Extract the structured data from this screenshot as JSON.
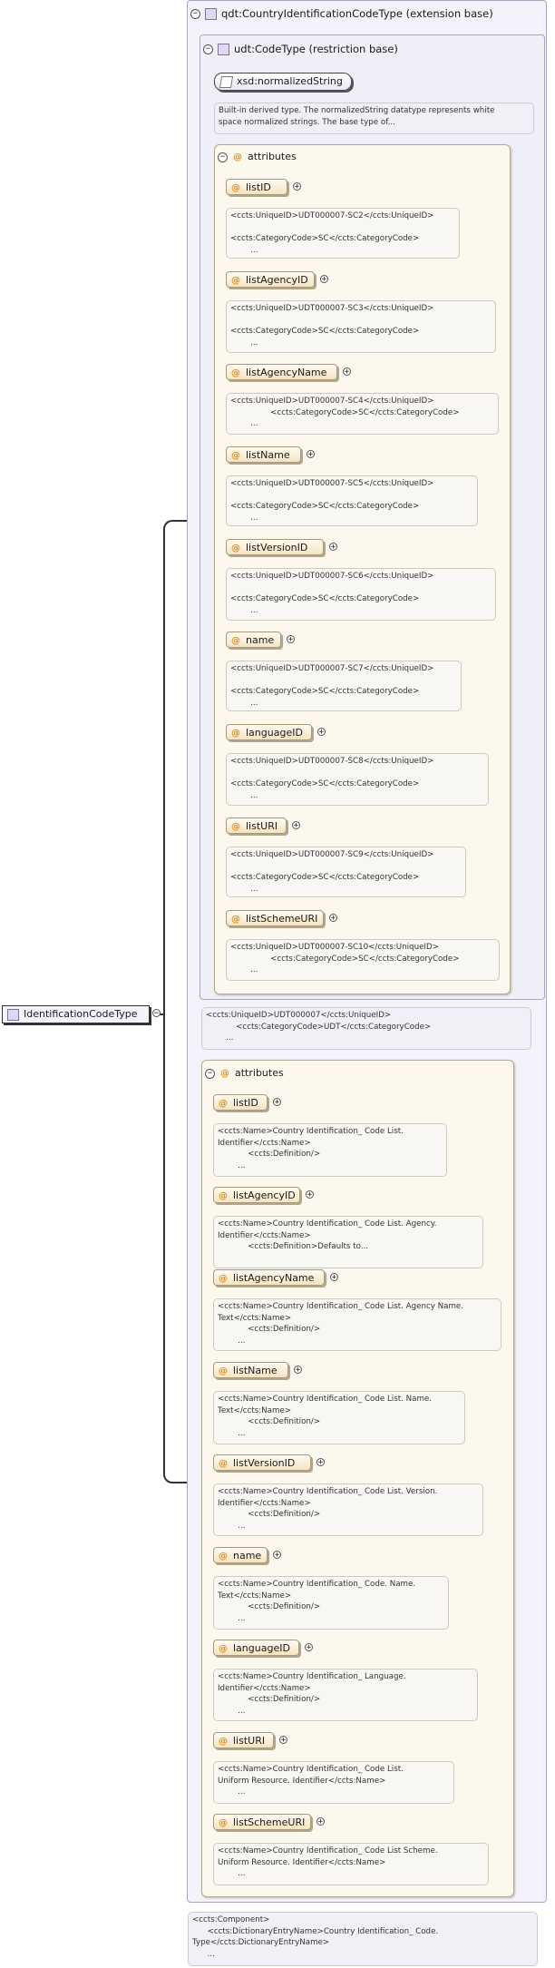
{
  "root": {
    "label": "IdentificationCodeType"
  },
  "extension": {
    "label": "qdt:CountryIdentificationCodeType (extension base)"
  },
  "restriction": {
    "label": "udt:CodeType (restriction base)"
  },
  "builtin": {
    "label": "xsd:normalizedString",
    "doc": "Built-in derived type. The normalizedString datatype represents white\nspace normalized strings. The base type of..."
  },
  "inner_attributes": {
    "title": "attributes",
    "items": [
      {
        "name": "listID",
        "doc": "<ccts:UniqueID>UDT000007-SC2</ccts:UniqueID>\n\n<ccts:CategoryCode>SC</ccts:CategoryCode>\n        ..."
      },
      {
        "name": "listAgencyID",
        "doc": "<ccts:UniqueID>UDT000007-SC3</ccts:UniqueID>\n\n<ccts:CategoryCode>SC</ccts:CategoryCode>\n        ..."
      },
      {
        "name": "listAgencyName",
        "doc": "<ccts:UniqueID>UDT000007-SC4</ccts:UniqueID>\n                <ccts:CategoryCode>SC</ccts:CategoryCode>\n        ..."
      },
      {
        "name": "listName",
        "doc": "<ccts:UniqueID>UDT000007-SC5</ccts:UniqueID>\n\n<ccts:CategoryCode>SC</ccts:CategoryCode>\n        ..."
      },
      {
        "name": "listVersionID",
        "doc": "<ccts:UniqueID>UDT000007-SC6</ccts:UniqueID>\n\n<ccts:CategoryCode>SC</ccts:CategoryCode>\n        ..."
      },
      {
        "name": "name",
        "doc": "<ccts:UniqueID>UDT000007-SC7</ccts:UniqueID>\n\n<ccts:CategoryCode>SC</ccts:CategoryCode>\n        ..."
      },
      {
        "name": "languageID",
        "doc": "<ccts:UniqueID>UDT000007-SC8</ccts:UniqueID>\n\n<ccts:CategoryCode>SC</ccts:CategoryCode>\n        ..."
      },
      {
        "name": "listURI",
        "doc": "<ccts:UniqueID>UDT000007-SC9</ccts:UniqueID>\n\n<ccts:CategoryCode>SC</ccts:CategoryCode>\n        ..."
      },
      {
        "name": "listSchemeURI",
        "doc": "<ccts:UniqueID>UDT000007-SC10</ccts:UniqueID>\n                <ccts:CategoryCode>SC</ccts:CategoryCode>\n        ..."
      }
    ]
  },
  "restriction_doc": "<ccts:UniqueID>UDT000007</ccts:UniqueID>\n            <ccts:CategoryCode>UDT</ccts:CategoryCode>\n        ...",
  "outer_attributes": {
    "title": "attributes",
    "items": [
      {
        "name": "listID",
        "doc": "<ccts:Name>Country Identification_ Code List.\nIdentifier</ccts:Name>\n            <ccts:Definition/>\n        ..."
      },
      {
        "name": "listAgencyID",
        "doc": "<ccts:Name>Country Identification_ Code List. Agency.\nIdentifier</ccts:Name>\n            <ccts:Definition>Defaults to..."
      },
      {
        "name": "listAgencyName",
        "doc": "<ccts:Name>Country Identification_ Code List. Agency Name.\nText</ccts:Name>\n            <ccts:Definition/>\n        ..."
      },
      {
        "name": "listName",
        "doc": "<ccts:Name>Country Identification_ Code List. Name.\nText</ccts:Name>\n            <ccts:Definition/>\n        ..."
      },
      {
        "name": "listVersionID",
        "doc": "<ccts:Name>Country Identification_ Code List. Version.\nIdentifier</ccts:Name>\n            <ccts:Definition/>\n        ..."
      },
      {
        "name": "name",
        "doc": "<ccts:Name>Country Identification_ Code. Name.\nText</ccts:Name>\n            <ccts:Definition/>\n        ..."
      },
      {
        "name": "languageID",
        "doc": "<ccts:Name>Country Identification_ Language.\nIdentifier</ccts:Name>\n            <ccts:Definition/>\n        ..."
      },
      {
        "name": "listURI",
        "doc": "<ccts:Name>Country Identification_ Code List.\nUniform Resource. Identifier</ccts:Name>\n        ..."
      },
      {
        "name": "listSchemeURI",
        "doc": "<ccts:Name>Country Identification_ Code List Scheme.\nUniform Resource. Identifier</ccts:Name>\n        ..."
      }
    ]
  },
  "component_doc": "<ccts:Component>\n      <ccts:DictionaryEntryName>Country Identification_ Code.\nType</ccts:DictionaryEntryName>\n      ..."
}
